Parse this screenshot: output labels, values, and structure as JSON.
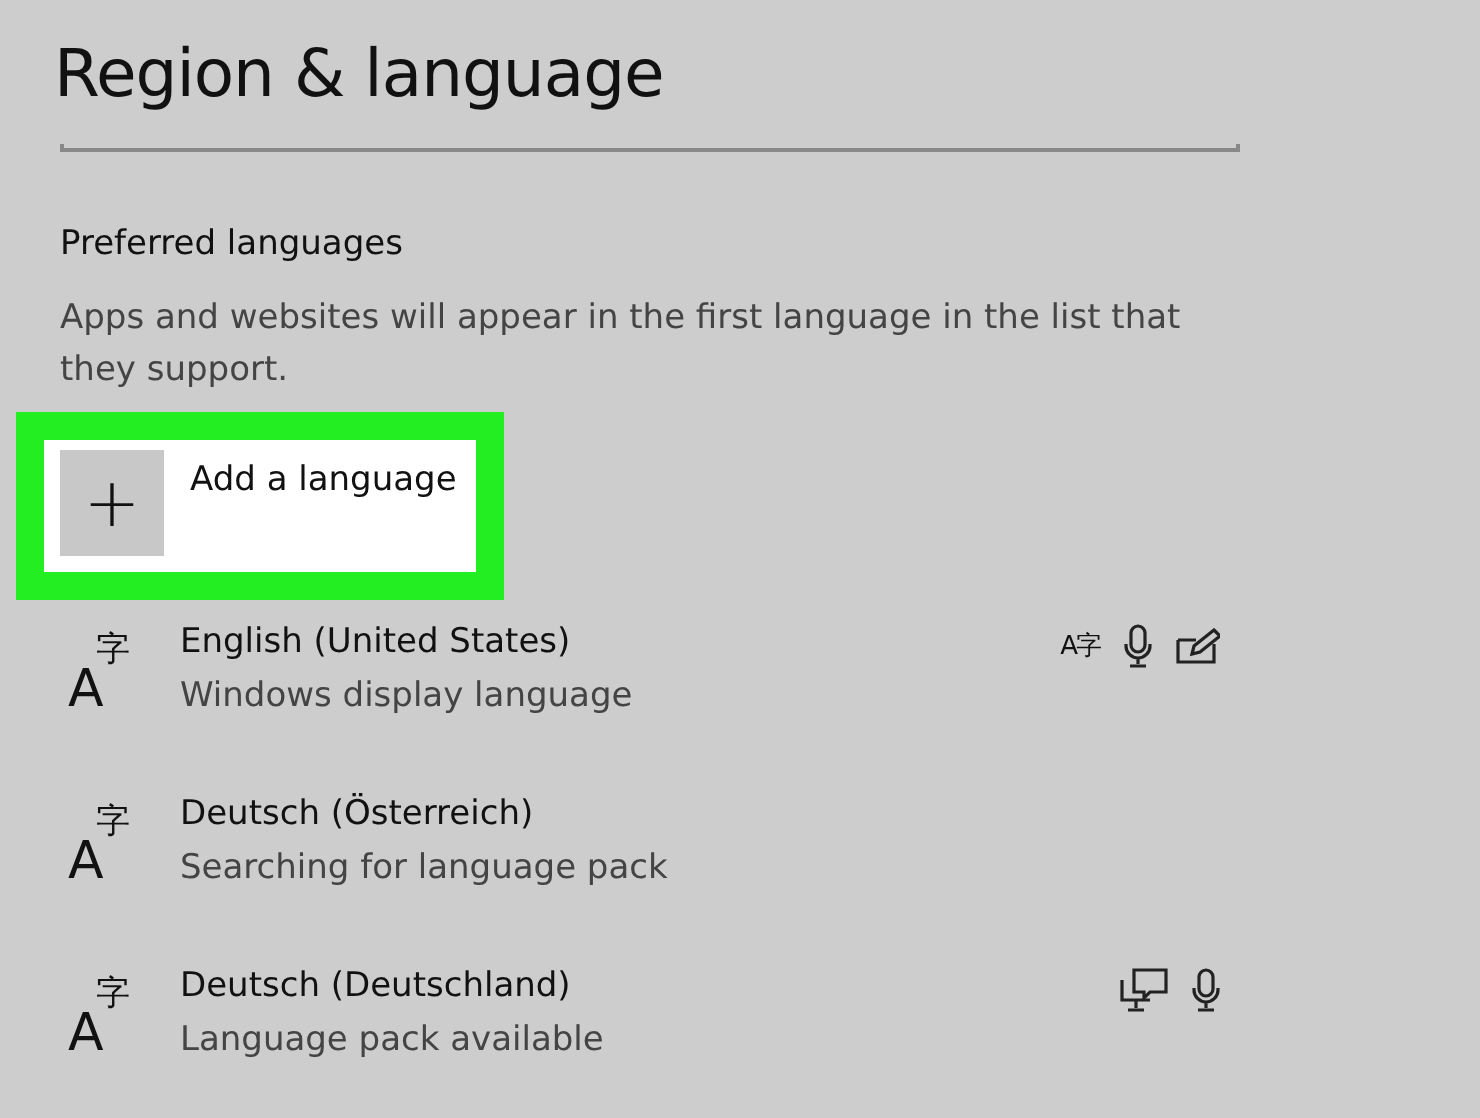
{
  "title": "Region & language",
  "section": {
    "heading": "Preferred languages",
    "description": "Apps and websites will appear in the first language in the list that they support."
  },
  "add_button": {
    "icon": "+",
    "label": "Add a language",
    "highlighted": true
  },
  "languages": [
    {
      "glyph_latin": "A",
      "glyph_cjk": "字",
      "name": "English (United States)",
      "status": "Windows display language",
      "features": [
        {
          "kind": "text",
          "text": "A字"
        },
        {
          "kind": "speech"
        },
        {
          "kind": "handwriting"
        }
      ]
    },
    {
      "glyph_latin": "A",
      "glyph_cjk": "字",
      "name": "Deutsch (Österreich)",
      "status": "Searching for language pack"
    },
    {
      "glyph_latin": "A",
      "glyph_cjk": "字",
      "name": "Deutsch (Deutschland)",
      "status": "Language pack available",
      "features": [
        {
          "kind": "display"
        },
        {
          "kind": "speech"
        }
      ]
    }
  ]
}
